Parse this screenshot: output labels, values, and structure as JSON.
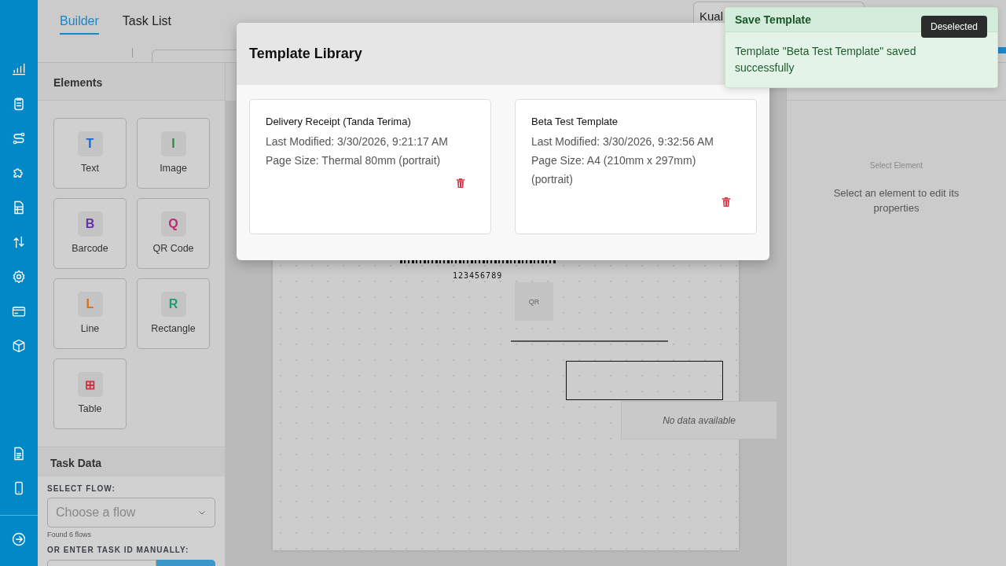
{
  "header": {
    "tabs": [
      {
        "label": "Builder",
        "selected": true
      },
      {
        "label": "Task List",
        "selected": false
      }
    ],
    "location_field": {
      "value": "Kual"
    }
  },
  "elements_panel": {
    "title": "Elements",
    "items": [
      {
        "glyph": "T",
        "label": "Text",
        "color": "#1a66d2"
      },
      {
        "glyph": "I",
        "label": "Image",
        "color": "#23913d"
      },
      {
        "glyph": "B",
        "label": "Barcode",
        "color": "#6434a8"
      },
      {
        "glyph": "Q",
        "label": "QR Code",
        "color": "#c2286e"
      },
      {
        "glyph": "L",
        "label": "Line",
        "color": "#d9700f"
      },
      {
        "glyph": "R",
        "label": "Rectangle",
        "color": "#1f9e76"
      },
      {
        "glyph": "⊞",
        "label": "Table",
        "color": "#d32f3f"
      }
    ]
  },
  "task_data": {
    "title": "Task Data",
    "flow_label": "SELECT FLOW:",
    "flow_select": {
      "placeholder": "Choose a flow"
    },
    "flow_hint": "Found 6 flows",
    "task_id_label": "OR ENTER TASK ID MANUALLY:"
  },
  "canvas": {
    "barcode_text": "123456789",
    "qr_label": "QR",
    "table_empty": "No data available"
  },
  "properties_panel": {
    "title": "Select Element",
    "hint": "Select an element to edit its properties"
  },
  "modal": {
    "title": "Template Library",
    "templates": [
      {
        "name": "Delivery Receipt (Tanda Terima)",
        "modified": "Last Modified: 3/30/2026, 9:21:17 AM",
        "page_size": "Page Size: Thermal 80mm (portrait)"
      },
      {
        "name": "Beta Test Template",
        "modified": "Last Modified: 3/30/2026, 9:32:56 AM",
        "page_size": "Page Size: A4 (210mm x 297mm) (portrait)"
      }
    ]
  },
  "toast": {
    "title": "Save Template",
    "message": "Template \"Beta Test Template\" saved successfully"
  },
  "tooltip": {
    "text": "Deselected"
  }
}
